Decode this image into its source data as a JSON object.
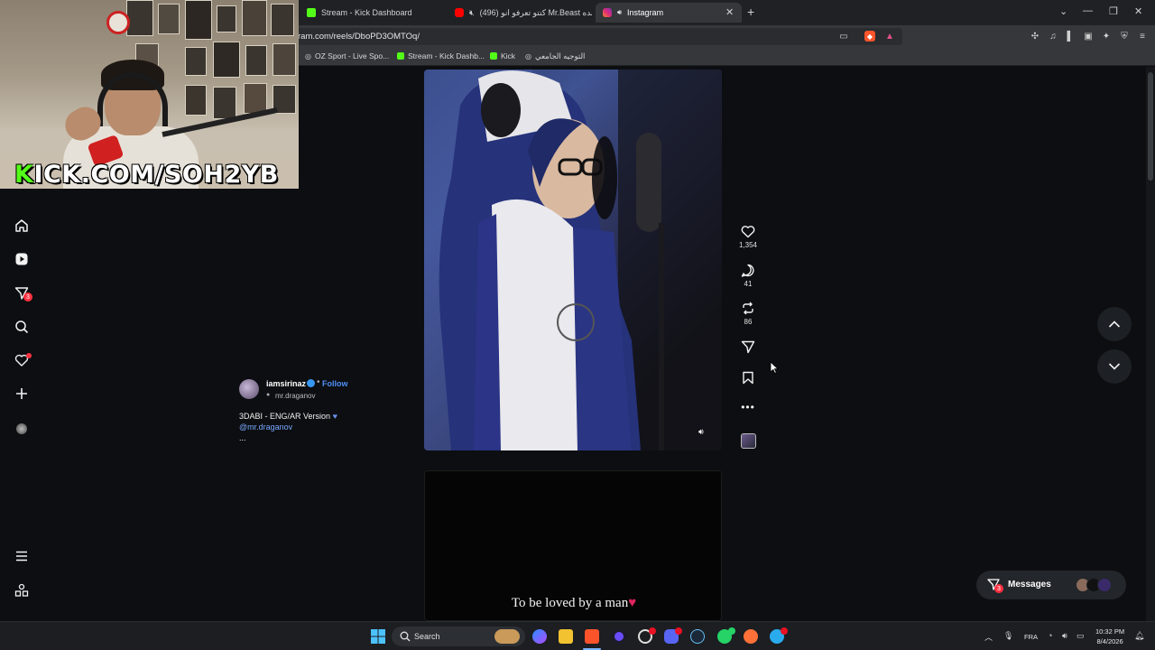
{
  "browser": {
    "tabs": [
      {
        "label": "Stream - Kick Dashboard",
        "favicon": "kick-icon",
        "active": false
      },
      {
        "label": "(496) كنتو تعرفو انو Mr.Beast عنده",
        "favicon": "youtube-icon",
        "muted": true,
        "active": false
      },
      {
        "label": "Instagram",
        "favicon": "instagram-icon",
        "audio": true,
        "active": true
      }
    ],
    "new_tab_label": "+",
    "url": "ram.com/reels/DboPD3OMTOq/",
    "bookmarks": [
      {
        "label": "OZ Sport - Live Spo...",
        "icon": "globe-icon"
      },
      {
        "label": "Stream - Kick Dashb...",
        "icon": "kick-icon"
      },
      {
        "label": "Kick",
        "icon": "kick-icon"
      },
      {
        "label": "التوجيه الجامعي",
        "icon": "globe-icon"
      }
    ]
  },
  "webcam": {
    "overlay_text_k": "K",
    "overlay_text_rest": "ICK.COM/SOH2YB"
  },
  "sidebar": {
    "items": [
      {
        "name": "home",
        "icon": "home-icon"
      },
      {
        "name": "reels",
        "icon": "reels-icon"
      },
      {
        "name": "messages",
        "icon": "send-icon",
        "badge": "3"
      },
      {
        "name": "search",
        "icon": "search-icon"
      },
      {
        "name": "notifications",
        "icon": "heart-icon",
        "dot": true
      },
      {
        "name": "create",
        "icon": "plus-icon"
      },
      {
        "name": "profile",
        "icon": "avatar-icon"
      },
      {
        "name": "more",
        "icon": "menu-icon"
      },
      {
        "name": "also-from-meta",
        "icon": "grid-icon"
      }
    ]
  },
  "reel": {
    "author": "iamsirinaz",
    "follow_label": "Follow",
    "audio": "mr.draganov",
    "caption_line1": "3DABI - ENG/AR Version",
    "caption_mention": "@mr.draganov",
    "caption_more": "...",
    "likes": "1,354",
    "comments": "41",
    "reposts": "86"
  },
  "next_reel": {
    "caption": "To be loved by a man"
  },
  "messages_button": {
    "label": "Messages",
    "badge": "3"
  },
  "taskbar": {
    "search_label": "Search",
    "lang": "FRA",
    "time": "10:32 PM",
    "date": "8/4/2026"
  },
  "colors": {
    "kick_green": "#53fc18",
    "ig_blue": "#4f8ef7",
    "badge_red": "#ff3040"
  }
}
